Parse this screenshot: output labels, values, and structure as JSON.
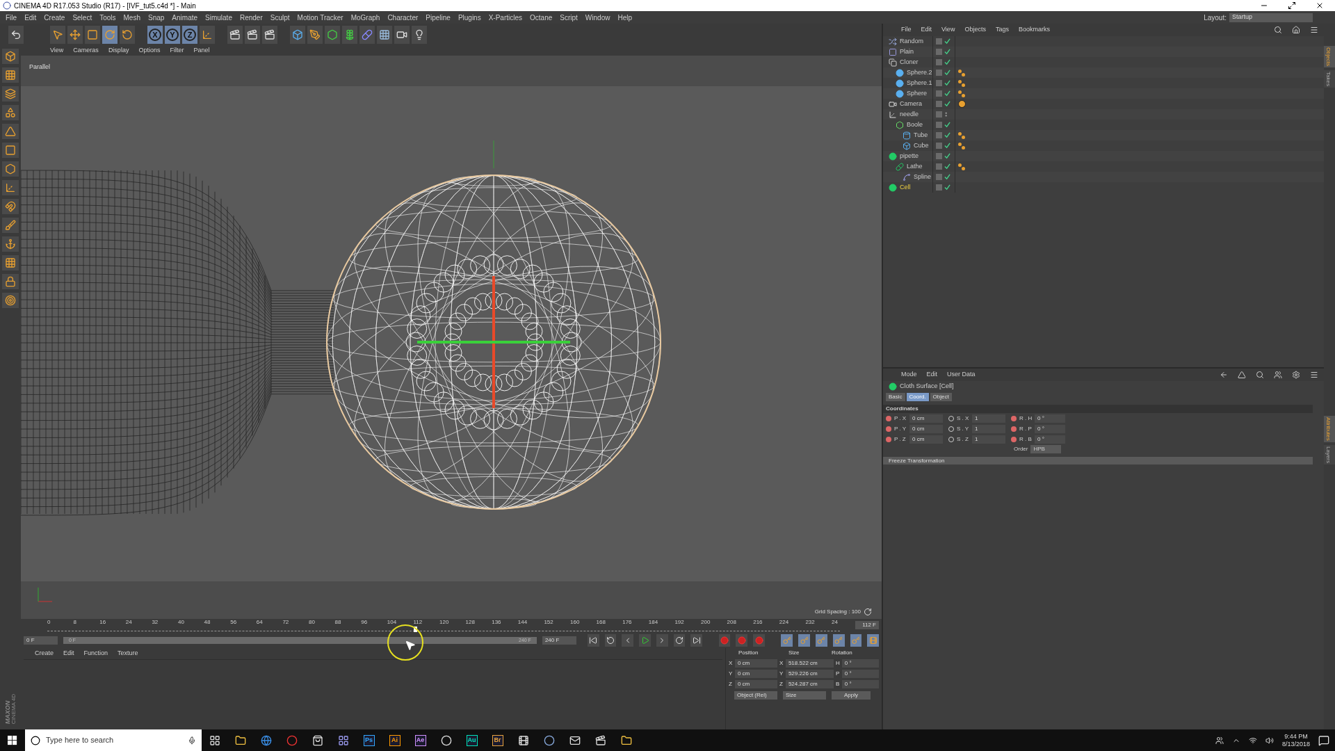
{
  "window": {
    "title": "CINEMA 4D R17.053 Studio (R17) - [IVF_tut5.c4d *] - Main"
  },
  "menu_bar": [
    "File",
    "Edit",
    "Create",
    "Select",
    "Tools",
    "Mesh",
    "Snap",
    "Animate",
    "Simulate",
    "Render",
    "Sculpt",
    "Motion Tracker",
    "MoGraph",
    "Character",
    "Pipeline",
    "Plugins",
    "X-Particles",
    "Octane",
    "Script",
    "Window",
    "Help"
  ],
  "layout": {
    "label": "Layout:",
    "value": "Startup"
  },
  "toolbar": {
    "axis_buttons": [
      "X",
      "Y",
      "Z"
    ]
  },
  "viewport": {
    "menu": [
      "View",
      "Cameras",
      "Display",
      "Options",
      "Filter",
      "Panel"
    ],
    "camera": "Parallel",
    "grid_spacing": "Grid Spacing : 100"
  },
  "timeline": {
    "ticks": [
      "0",
      "8",
      "16",
      "24",
      "32",
      "40",
      "48",
      "56",
      "64",
      "72",
      "80",
      "88",
      "96",
      "104",
      "112",
      "120",
      "128",
      "136",
      "144",
      "152",
      "160",
      "168",
      "176",
      "184",
      "192",
      "200",
      "208",
      "216",
      "224",
      "232",
      "24"
    ],
    "playhead": {
      "level": 0.467
    },
    "current_frame": "112 F",
    "start_field": "0 F",
    "range_start": "0 F",
    "range_end": "240 F",
    "end_field": "240 F"
  },
  "material_manager": {
    "menu": [
      "Create",
      "Edit",
      "Function",
      "Texture"
    ]
  },
  "logo": {
    "line_1": "MAXON",
    "line_2": "CINEMA 4D"
  },
  "coordinates": {
    "headers": [
      "Position",
      "Size",
      "Rotation"
    ],
    "rows": [
      {
        "axis": "X",
        "position": "0 cm",
        "size_axis": "X",
        "size": "518.522 cm",
        "rot_axis": "H",
        "rotation": "0 °"
      },
      {
        "axis": "Y",
        "position": "0 cm",
        "size_axis": "Y",
        "size": "529.226 cm",
        "rot_axis": "P",
        "rotation": "0 °"
      },
      {
        "axis": "Z",
        "position": "0 cm",
        "size_axis": "Z",
        "size": "524.287 cm",
        "rot_axis": "B",
        "rotation": "0 °"
      }
    ],
    "mode": "Object (Rel)",
    "size_mode": "Size",
    "apply": "Apply"
  },
  "object_manager": {
    "menu": [
      "File",
      "Edit",
      "View",
      "Objects",
      "Tags",
      "Bookmarks"
    ],
    "objects": [
      {
        "name": "Random",
        "kind": "random",
        "selected": false,
        "enabled": true
      },
      {
        "name": "Plain",
        "kind": "plain",
        "selected": false,
        "enabled": true
      },
      {
        "name": "Cloner",
        "kind": "cloner",
        "selected": false,
        "enabled": true,
        "children": [
          {
            "name": "Sphere.2",
            "kind": "sphere",
            "selected": false,
            "enabled": true,
            "tags": [
              {
                "kind": "phong"
              }
            ]
          },
          {
            "name": "Sphere.1",
            "kind": "sphere",
            "selected": false,
            "enabled": true,
            "tags": [
              {
                "kind": "phong"
              }
            ]
          },
          {
            "name": "Sphere",
            "kind": "sphere",
            "selected": false,
            "enabled": true,
            "tags": [
              {
                "kind": "phong"
              }
            ]
          }
        ]
      },
      {
        "name": "Camera",
        "kind": "camera",
        "selected": false,
        "enabled": true,
        "tags": [
          {
            "kind": "protection"
          }
        ]
      },
      {
        "name": "needle",
        "kind": "null",
        "selected": false,
        "enabled": false,
        "children": [
          {
            "name": "Boole",
            "kind": "boole",
            "selected": false,
            "enabled": true,
            "children": [
              {
                "name": "Tube",
                "kind": "tube",
                "selected": false,
                "enabled": true,
                "tags": [
                  {
                    "kind": "phong"
                  }
                ]
              },
              {
                "name": "Cube",
                "kind": "cube",
                "selected": false,
                "enabled": true,
                "tags": [
                  {
                    "kind": "phong"
                  }
                ]
              }
            ]
          }
        ]
      },
      {
        "name": "pipette",
        "kind": "cloth",
        "selected": false,
        "enabled": true,
        "children": [
          {
            "name": "Lathe",
            "kind": "lathe",
            "selected": false,
            "enabled": true,
            "tags": [
              {
                "kind": "phong"
              }
            ],
            "children": [
              {
                "name": "Spline",
                "kind": "spline",
                "selected": false,
                "enabled": true
              }
            ]
          }
        ]
      },
      {
        "name": "Cell",
        "kind": "cloth",
        "selected": true,
        "enabled": true
      }
    ]
  },
  "attributes": {
    "menu": [
      "Mode",
      "Edit",
      "User Data"
    ],
    "object_title": "Cloth Surface [Cell]",
    "tabs": [
      {
        "label": "Basic",
        "selected": false
      },
      {
        "label": "Coord.",
        "selected": true
      },
      {
        "label": "Object",
        "selected": false
      }
    ],
    "section": "Coordinates",
    "rows": [
      {
        "p_label": "P . X",
        "p_value": "0 cm",
        "s_label": "S . X",
        "s_value": "1",
        "r_label": "R . H",
        "r_value": "0 °"
      },
      {
        "p_label": "P . Y",
        "p_value": "0 cm",
        "s_label": "S . Y",
        "s_value": "1",
        "r_label": "R . P",
        "r_value": "0 °"
      },
      {
        "p_label": "P . Z",
        "p_value": "0 cm",
        "s_label": "S . Z",
        "s_value": "1",
        "r_label": "R . B",
        "r_value": "0 °"
      }
    ],
    "order_label": "Order",
    "order_value": "HPB",
    "collapsed_section": "Freeze Transformation"
  },
  "side_tabs_top": [
    {
      "label": "Objects",
      "selected": true
    },
    {
      "label": "Takes",
      "selected": false
    }
  ],
  "side_tabs_bottom": [
    {
      "label": "Attributes",
      "selected": true
    },
    {
      "label": "Layers",
      "selected": false
    }
  ],
  "taskbar": {
    "search_placeholder": "Type here to search",
    "apps": [
      {
        "kind": "icon"
      },
      {
        "kind": "icon"
      },
      {
        "kind": "icon"
      },
      {
        "kind": "icon"
      },
      {
        "kind": "icon"
      },
      {
        "kind": "text",
        "label": "Ps",
        "color": "#31a8ff"
      },
      {
        "kind": "text",
        "label": "Ai",
        "color": "#ff9a00"
      },
      {
        "kind": "text",
        "label": "Ae",
        "color": "#d291ff"
      },
      {
        "kind": "icon"
      },
      {
        "kind": "text",
        "label": "Au",
        "color": "#00e4bb"
      },
      {
        "kind": "text",
        "label": "Br",
        "color": "#e8a33d"
      },
      {
        "kind": "icon"
      },
      {
        "kind": "icon"
      },
      {
        "kind": "icon"
      },
      {
        "kind": "icon"
      },
      {
        "kind": "icon"
      }
    ],
    "time": "9:44 PM",
    "date": "8/13/2018"
  }
}
